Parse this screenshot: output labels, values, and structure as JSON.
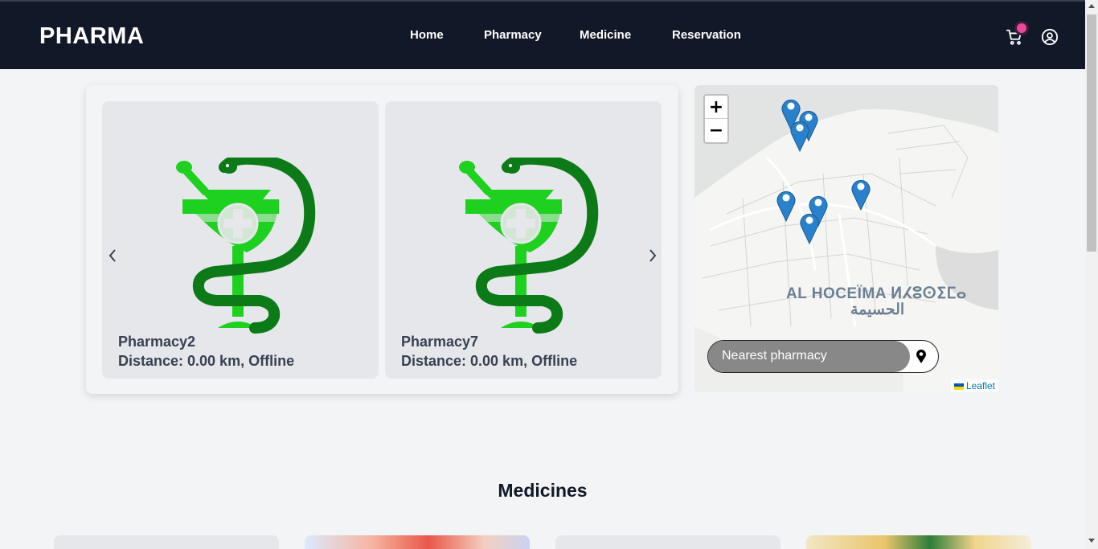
{
  "header": {
    "brand": "PHARMA",
    "nav": [
      {
        "label": "Home"
      },
      {
        "label": "Pharmacy"
      },
      {
        "label": "Medicine"
      },
      {
        "label": "Reservation"
      }
    ],
    "cart_icon": "cart-icon",
    "user_icon": "user-circle-icon"
  },
  "carousel": {
    "cards": [
      {
        "name": "Pharmacy2",
        "meta": "Distance: 0.00 km, Offline"
      },
      {
        "name": "Pharmacy7",
        "meta": "Distance: 0.00 km, Offline"
      }
    ],
    "prev_icon": "chevron-left-icon",
    "next_icon": "chevron-right-icon"
  },
  "map": {
    "zoom_in": "+",
    "zoom_out": "−",
    "city_label": "AL HOCEÏMA ⵍⵃⵓⵙⵉⵎⴰ",
    "city_label_ar": "الحسيمة",
    "nearest_label": "Nearest pharmacy",
    "attribution": "Leaflet",
    "marker_count": 7
  },
  "medicines": {
    "title": "Medicines"
  },
  "colors": {
    "header_bg": "#111827",
    "page_bg": "#f3f4f6",
    "card_bg": "#e5e7eb",
    "accent_green": "#22c55e",
    "cart_badge": "#ec4899",
    "marker_blue": "#2a81cb"
  }
}
